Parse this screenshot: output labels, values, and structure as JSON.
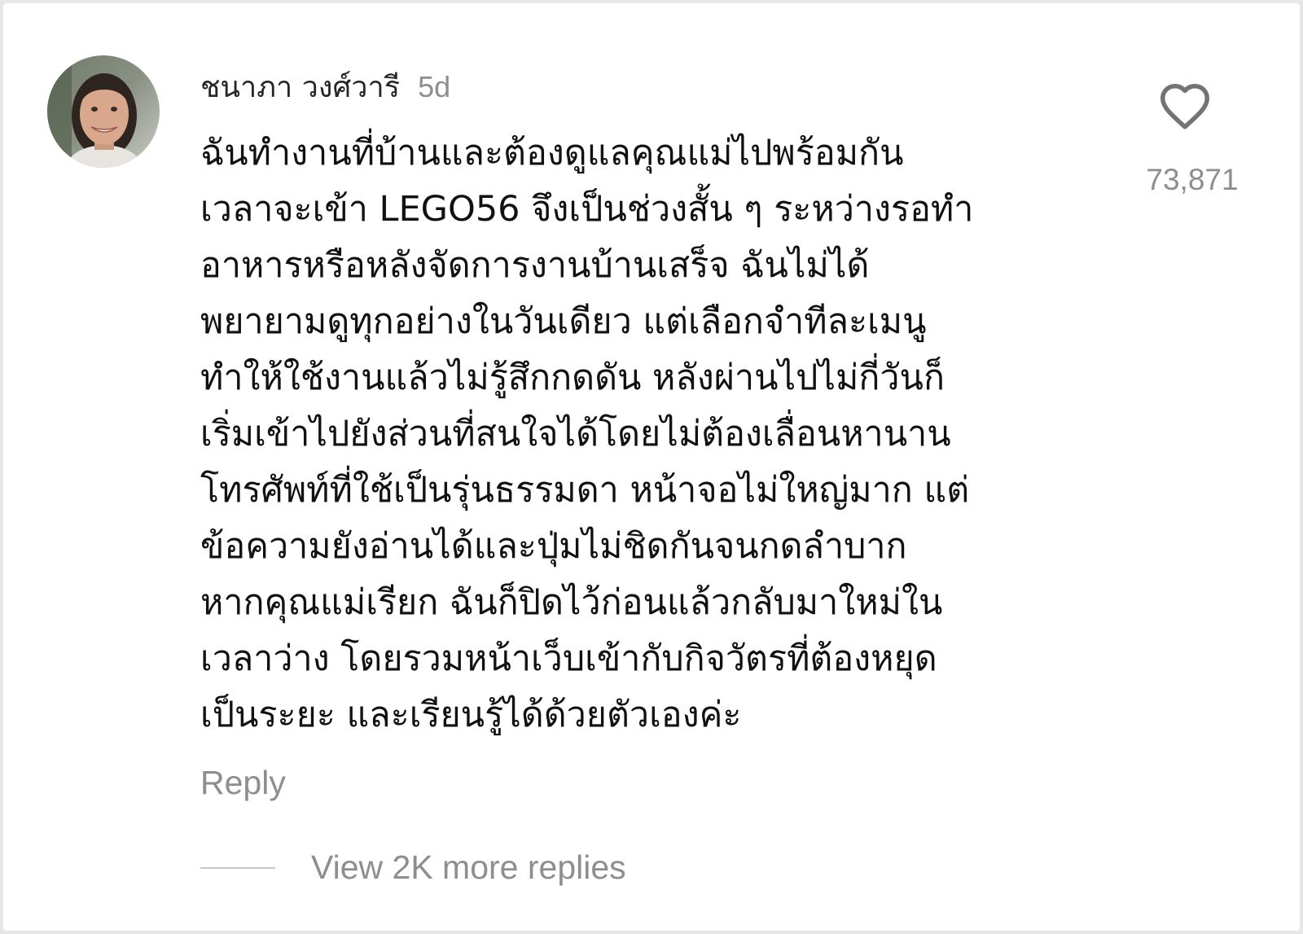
{
  "comment": {
    "username": "ชนาภา วงศ์วารี",
    "timestamp": "5d",
    "text_lines": [
      "ฉันทำงานที่บ้านและต้องดูแลคุณแม่ไปพร้อมกัน",
      "เวลาจะเข้า LEGO56 จึงเป็นช่วงสั้น ๆ ระหว่างรอทำ",
      "อาหารหรือหลังจัดการงานบ้านเสร็จ ฉันไม่ได้",
      "พยายามดูทุกอย่างในวันเดียว แต่เลือกจำทีละเมนู",
      "ทำให้ใช้งานแล้วไม่รู้สึกกดดัน หลังผ่านไปไม่กี่วันก็",
      "เริ่มเข้าไปยังส่วนที่สนใจได้โดยไม่ต้องเลื่อนหานาน",
      "โทรศัพท์ที่ใช้เป็นรุ่นธรรมดา หน้าจอไม่ใหญ่มาก แต่",
      "ข้อความยังอ่านได้และปุ่มไม่ชิดกันจนกดลำบาก",
      "หากคุณแม่เรียก ฉันก็ปิดไว้ก่อนแล้วกลับมาใหม่ใน",
      "เวลาว่าง โดยรวมหน้าเว็บเข้ากับกิจวัตรที่ต้องหยุด",
      "เป็นระยะ และเรียนรู้ได้ด้วยตัวเองค่ะ"
    ],
    "like_icon": "heart-outline-icon",
    "like_count": "73,871",
    "reply_label": "Reply",
    "view_replies_label": "View 2K more replies"
  },
  "colors": {
    "text_primary": "#111111",
    "text_secondary": "#8e8e8e",
    "divider": "#c7c7c7"
  }
}
